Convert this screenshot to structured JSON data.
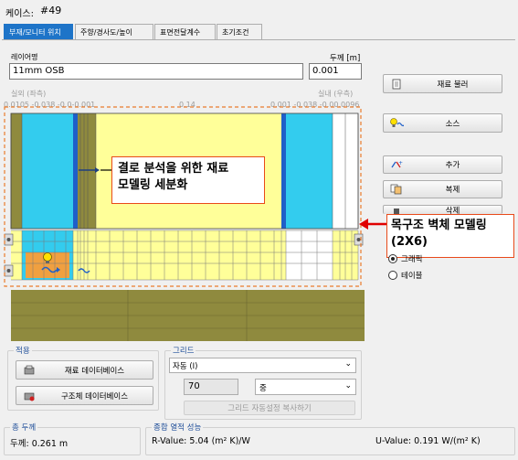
{
  "case": {
    "label": "케이스:",
    "value": "#49"
  },
  "tabs": [
    {
      "label": "부재/모니터 위치"
    },
    {
      "label": "주향/경사도/높이"
    },
    {
      "label": "표면전달계수"
    },
    {
      "label": "초기조건"
    }
  ],
  "layer": {
    "name_label": "레이어명",
    "name_value": "11mm OSB",
    "thickness_label": "두께 [m]",
    "thickness_value": "0.001"
  },
  "cross_section": {
    "exterior_label": "실외 (좌측)",
    "interior_label": "실내 (우측)",
    "left_coords": "0.0105 -0.038 -0.0-0.001",
    "center_coord": "0.14",
    "right_coords": "0.001 -0.038 -0.00.0096"
  },
  "side_buttons": {
    "load_material": "재료 불러",
    "source": "소스",
    "add": "추가",
    "duplicate": "복제",
    "delete": "삭제"
  },
  "view_options": {
    "graphic": "그래픽",
    "table": "테이블"
  },
  "callouts": {
    "mesh_line1": "결로 분석을 위한 재료",
    "mesh_line2": "모델링 세분화",
    "wall_line1": "목구조 벽체 모델링",
    "wall_line2": "(2X6)"
  },
  "apply_group": {
    "title": "적용",
    "material_db": "재료 데이터베이스",
    "assembly_db": "구조체 데이터베이스"
  },
  "grid_group": {
    "title": "그리드",
    "mode_value": "자동 (I)",
    "count_value": "70",
    "density_value": "중",
    "copy_button": "그리드 자동설정 복사하기"
  },
  "total_thickness": {
    "title": "총 두께",
    "text": "두께: 0.261 m"
  },
  "thermal": {
    "title": "종합 열적 성능",
    "r_value": "R-Value: 5.04 (m² K)/W",
    "u_value": "U-Value: 0.191 W/(m² K)"
  },
  "colors": {
    "accent": "#1e74c8",
    "dashed": "#ea7b2c",
    "arrow": "#e00000",
    "layer_yellow": "#ffff99",
    "layer_cyan": "#33ccee",
    "wood": "#8f8a3e"
  }
}
